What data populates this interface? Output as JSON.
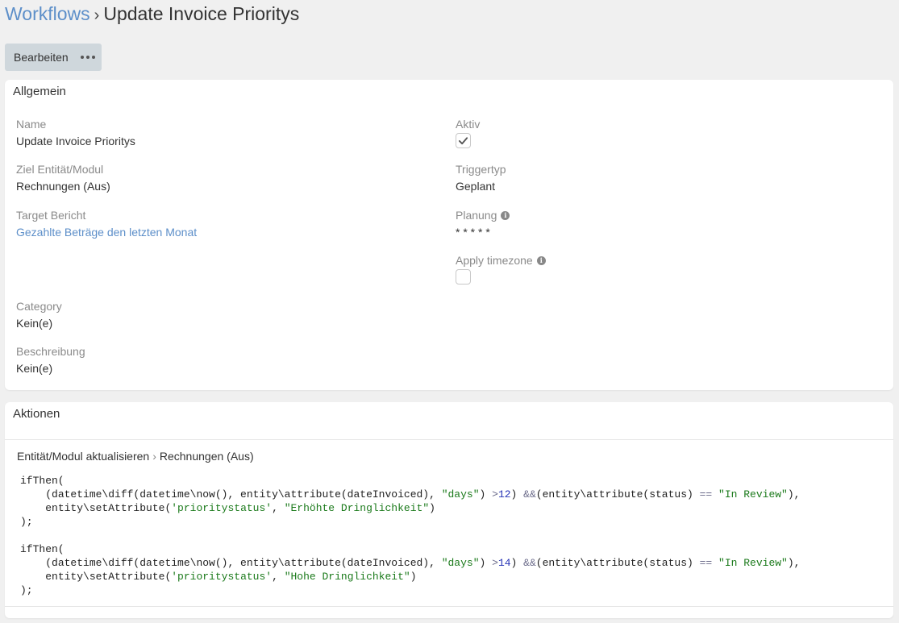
{
  "breadcrumb": {
    "root": "Workflows",
    "separator": "›",
    "current": "Update Invoice Prioritys"
  },
  "toolbar": {
    "edit_label": "Bearbeiten"
  },
  "general": {
    "title": "Allgemein",
    "name_label": "Name",
    "name_value": "Update Invoice Prioritys",
    "target_label": "Ziel Entität/Modul",
    "target_value": "Rechnungen (Aus)",
    "report_label": "Target Bericht",
    "report_value": "Gezahlte Beträge den letzten Monat",
    "category_label": "Category",
    "category_value": "Kein(e)",
    "description_label": "Beschreibung",
    "description_value": "Kein(e)",
    "active_label": "Aktiv",
    "active_checked": true,
    "triggertype_label": "Triggertyp",
    "triggertype_value": "Geplant",
    "schedule_label": "Planung",
    "schedule_value": "* * * * *",
    "timezone_label": "Apply timezone",
    "timezone_checked": false
  },
  "actions": {
    "title": "Aktionen",
    "action_type": "Entität/Modul aktualisieren",
    "action_separator": "›",
    "action_target": "Rechnungen (Aus)",
    "code": [
      {
        "fn": "ifThen(",
        "cond_prefix": "(datetime\\diff(datetime\\now(), entity\\attribute(dateInvoiced), ",
        "unit": "\"days\"",
        "cmp": " > ",
        "days": "12",
        "and": " && ",
        "cond_mid": "(entity\\attribute(status) ",
        "eq": "==",
        "status": "\"In Review\"",
        "set_prefix": "entity\\setAttribute(",
        "attr": "'prioritystatus'",
        "value": "\"Erhöhte Dringlichkeit\"",
        "end": ");"
      },
      {
        "fn": "ifThen(",
        "cond_prefix": "(datetime\\diff(datetime\\now(), entity\\attribute(dateInvoiced), ",
        "unit": "\"days\"",
        "cmp": " > ",
        "days": "14",
        "and": " && ",
        "cond_mid": "(entity\\attribute(status) ",
        "eq": "==",
        "status": "\"In Review\"",
        "set_prefix": "entity\\setAttribute(",
        "attr": "'prioritystatus'",
        "value": "\"Hohe Dringlichkeit\"",
        "end": ");"
      }
    ]
  }
}
